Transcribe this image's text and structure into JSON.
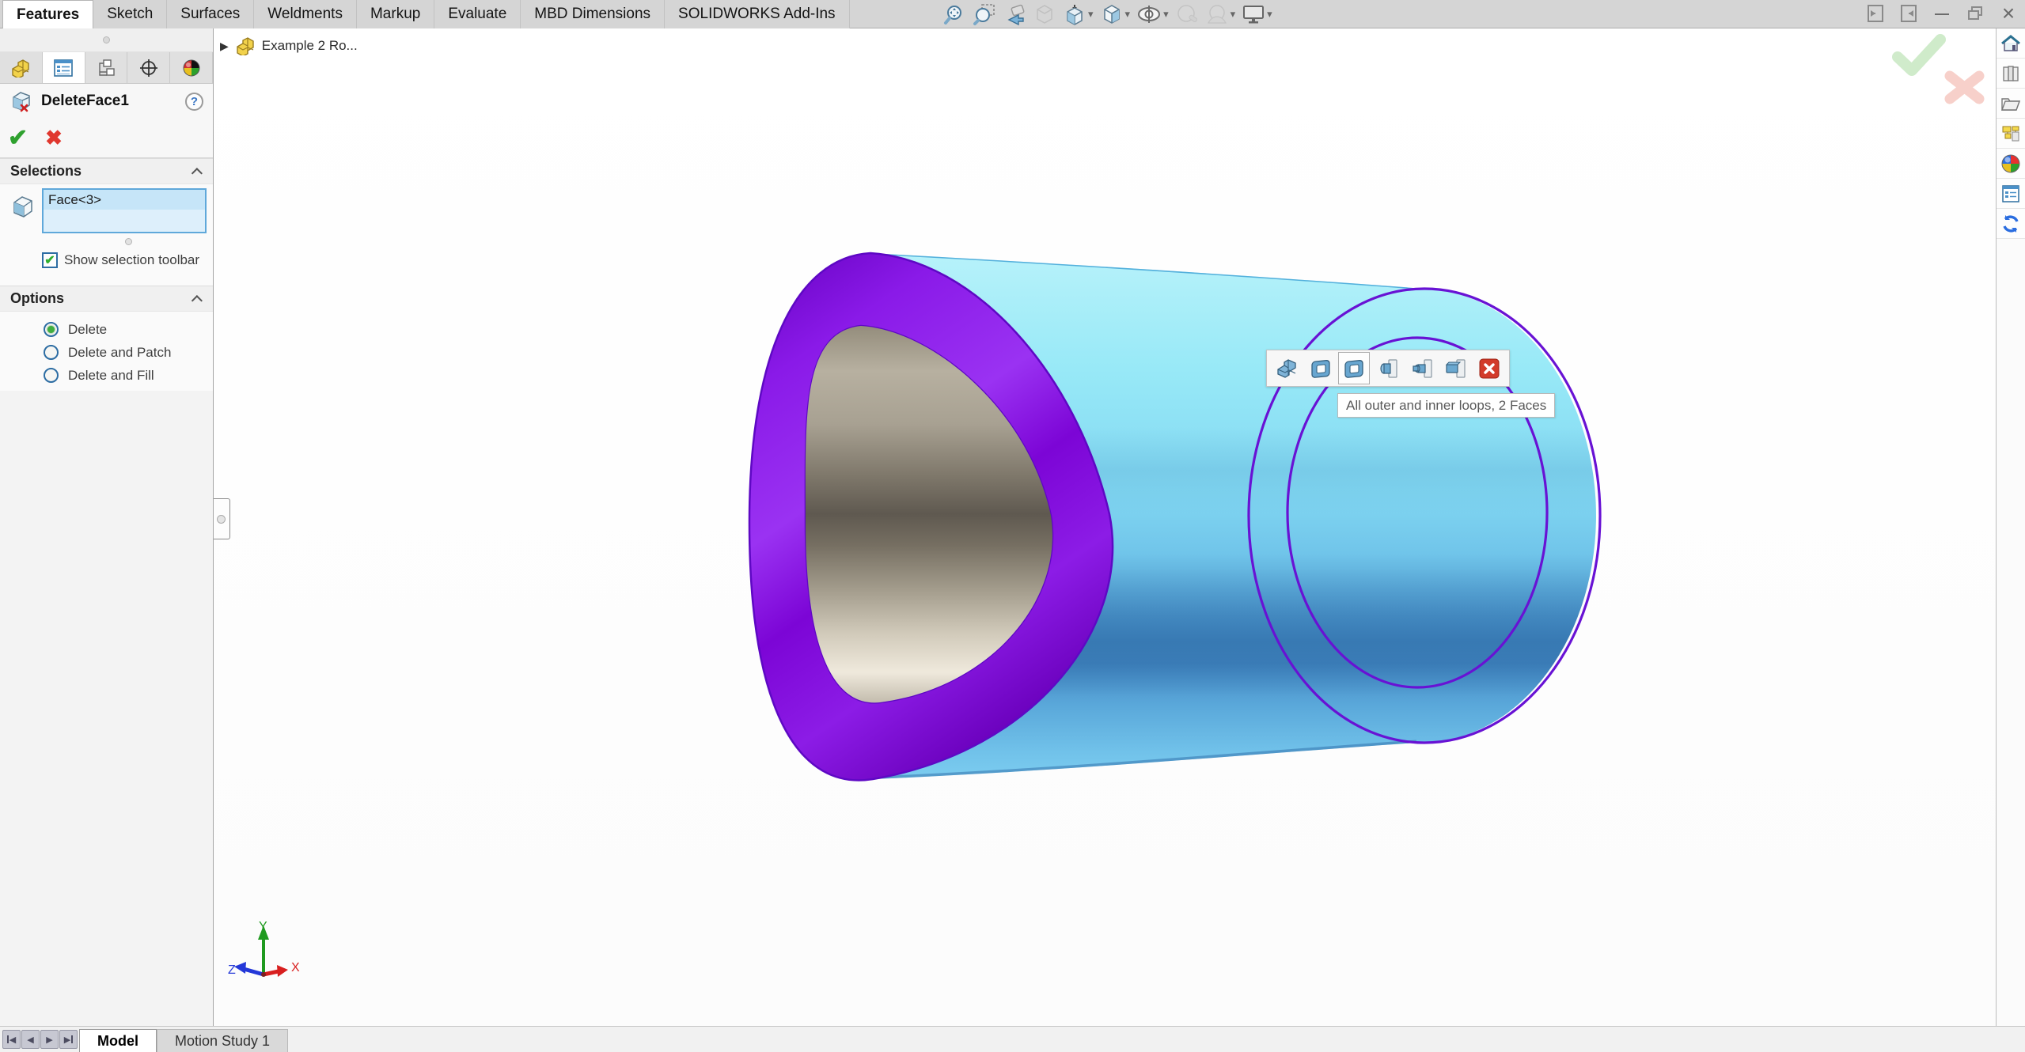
{
  "command_tabs": {
    "items": [
      {
        "label": "Features",
        "active": true
      },
      {
        "label": "Sketch",
        "active": false
      },
      {
        "label": "Surfaces",
        "active": false
      },
      {
        "label": "Weldments",
        "active": false
      },
      {
        "label": "Markup",
        "active": false
      },
      {
        "label": "Evaluate",
        "active": false
      },
      {
        "label": "MBD Dimensions",
        "active": false
      },
      {
        "label": "SOLIDWORKS Add-Ins",
        "active": false
      }
    ]
  },
  "view_toolbar": {
    "buttons": [
      {
        "name": "zoom-to-fit",
        "disabled": false,
        "dropdown": false
      },
      {
        "name": "zoom-to-area",
        "disabled": false,
        "dropdown": false
      },
      {
        "name": "previous-view",
        "disabled": false,
        "dropdown": false
      },
      {
        "name": "section-view",
        "disabled": true,
        "dropdown": false
      },
      {
        "name": "view-orientation",
        "disabled": false,
        "dropdown": true
      },
      {
        "name": "display-style",
        "disabled": false,
        "dropdown": true
      },
      {
        "name": "hide-show-items",
        "disabled": false,
        "dropdown": true
      },
      {
        "name": "edit-appearance",
        "disabled": true,
        "dropdown": false
      },
      {
        "name": "apply-scene",
        "disabled": true,
        "dropdown": true
      },
      {
        "name": "view-settings",
        "disabled": false,
        "dropdown": true
      }
    ],
    "caret_glyph": "▾"
  },
  "window_controls": {
    "buttons": [
      "collapse-left-pane",
      "collapse-right-pane",
      "minimize",
      "restore",
      "close"
    ],
    "minimize_glyph": "—",
    "close_glyph": "×"
  },
  "property_manager": {
    "panel_tabs": [
      "featuremanager-design-tree",
      "propertymanager",
      "configurationmanager",
      "dimxpertmanager",
      "displaymanager"
    ],
    "active_panel_tab_index": 1,
    "title": "DeleteFace1",
    "help_glyph": "?",
    "ok_glyph": "✔",
    "cancel_glyph": "✖",
    "selections": {
      "header": "Selections",
      "items": [
        "Face<3>"
      ],
      "checkbox_label": "Show selection toolbar",
      "checkbox_checked": true,
      "check_glyph": "✔"
    },
    "options": {
      "header": "Options",
      "radios": [
        {
          "label": "Delete",
          "selected": true
        },
        {
          "label": "Delete and Patch",
          "selected": false
        },
        {
          "label": "Delete and Fill",
          "selected": false
        }
      ]
    }
  },
  "viewport": {
    "flyout_tree_label": "Example 2 Ro...",
    "flyout_arrow_glyph": "▶",
    "selection_toolbar": {
      "buttons": [
        "select-feature",
        "select-outer-loop",
        "select-all-loops",
        "select-boss-faces",
        "select-stepped-boss-faces",
        "select-block-boss-faces",
        "close-selection-toolbar"
      ],
      "hovered_button_index": 2,
      "tooltip": "All outer and inner loops, 2 Faces"
    },
    "triad": {
      "x": "X",
      "y": "Y",
      "z": "Z"
    }
  },
  "task_pane": {
    "icons": [
      "solidworks-resources-home",
      "design-library",
      "file-explorer",
      "view-palette",
      "appearances-scenes",
      "custom-properties",
      "solidworks-sync"
    ]
  },
  "bottom_bar": {
    "nav_buttons": [
      "first-tab",
      "previous-tab",
      "next-tab",
      "last-tab"
    ],
    "nav_prev_glyph": "◀",
    "nav_next_glyph": "▶",
    "tabs": [
      {
        "label": "Model",
        "active": true
      },
      {
        "label": "Motion Study 1",
        "active": false
      }
    ]
  },
  "colors": {
    "selection_purple": "#7c0fd8",
    "edge_purple": "#6812d4",
    "body_cyan_light": "#b4f1f9",
    "body_cyan_deep": "#4489c4",
    "bore_tan": "#b7b0a0",
    "ok_green": "#2fa12f",
    "cancel_red": "#e0372e",
    "listbox_blue": "#c6e5f8"
  }
}
